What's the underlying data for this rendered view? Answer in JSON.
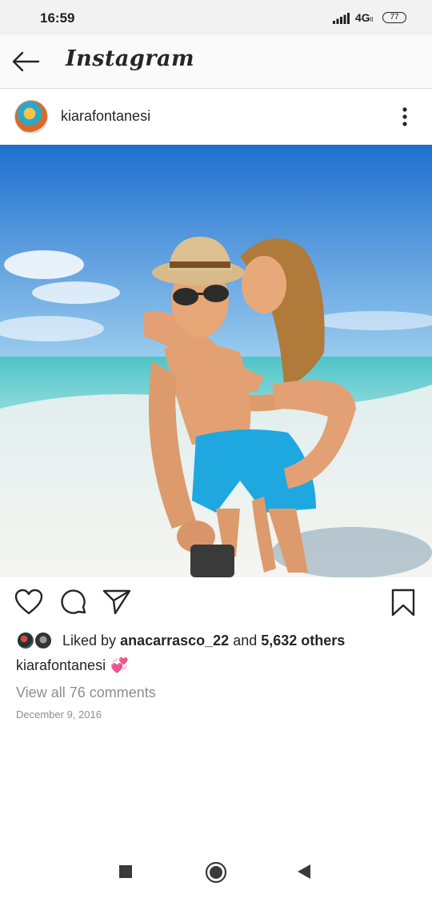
{
  "status_bar": {
    "time": "16:59",
    "network": "4G",
    "network_sub": "ll",
    "battery": "77"
  },
  "app_bar": {
    "brand": "Instagram",
    "back_icon": "arrow-left-icon"
  },
  "post": {
    "username": "kiarafontanesi",
    "more_icon": "more-vertical-icon",
    "photo_description_icon": "post-photo",
    "likes_prefix": "Liked by",
    "liked_by_user": "anacarrasco_22",
    "likes_and": "and",
    "likes_others": "5,632 others",
    "caption_user": "kiarafontanesi",
    "caption_emoji": "💞",
    "view_comments": "View all 76 comments",
    "date": "December 9, 2016"
  },
  "actions": {
    "like_icon": "heart-icon",
    "comment_icon": "comment-icon",
    "share_icon": "send-icon",
    "save_icon": "bookmark-icon"
  },
  "colors": {
    "status_bg": "#f2f2f2",
    "appbar_bg": "#fafafa",
    "text_primary": "#262626",
    "text_secondary": "#8e8e8e",
    "sky": "#2e7fd6",
    "sea": "#6fd3d6",
    "sand": "#eef1ee",
    "shorts": "#1fa8e0"
  }
}
